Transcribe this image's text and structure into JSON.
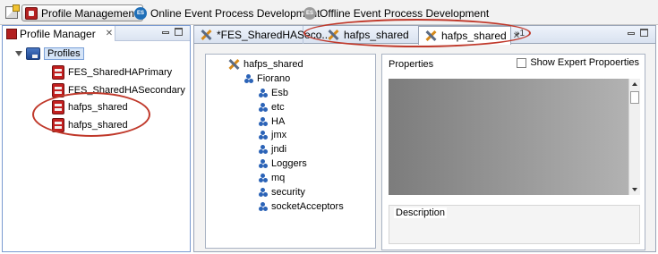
{
  "perspective_bar": {
    "items": [
      {
        "label": "Profile Management",
        "active": true
      },
      {
        "label": "Online Event Process Development",
        "badge": "ES"
      },
      {
        "label": "Offline Event Process Development",
        "badge": "ES"
      }
    ]
  },
  "profile_manager": {
    "view_title": "Profile Manager",
    "close_glyph": "✕",
    "root": "Profiles",
    "profiles": [
      "FES_SharedHAPrimary",
      "FES_SharedHASecondary",
      "hafps_shared",
      "hafps_shared"
    ]
  },
  "editor": {
    "tabs": [
      {
        "label": "*FES_SharedHASeco..."
      },
      {
        "label": "hafps_shared"
      },
      {
        "label": "hafps_shared",
        "active": true,
        "close_glyph": "✕"
      }
    ],
    "overflow_label": "»1",
    "config_tree": {
      "root": "hafps_shared",
      "group": "Fiorano",
      "children": [
        "Esb",
        "etc",
        "HA",
        "jmx",
        "jndi",
        "Loggers",
        "mq",
        "security",
        "socketAcceptors"
      ]
    },
    "properties": {
      "title": "Properties",
      "expert_label": "Show Expert Propoerties",
      "description_label": "Description"
    }
  },
  "colors": {
    "highlight_ellipse": "#c0392b",
    "selection": "#d5e4f7"
  }
}
